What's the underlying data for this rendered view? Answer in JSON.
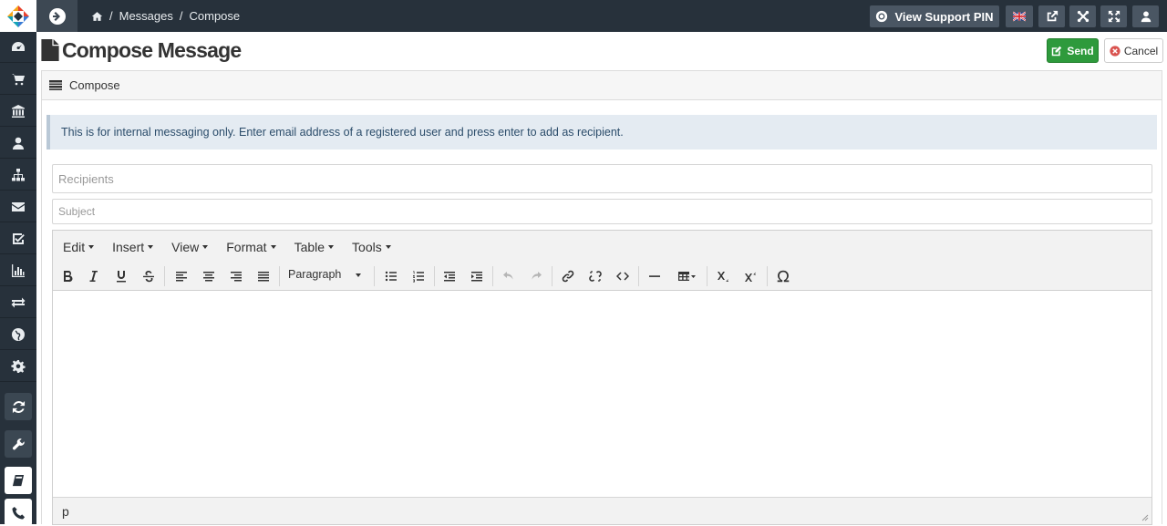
{
  "breadcrumb": {
    "current_section": "Messages",
    "separator": "/",
    "current_page": "Compose"
  },
  "topbar": {
    "support_pin_label": "View Support PIN"
  },
  "page": {
    "title": "Compose Message"
  },
  "actions": {
    "send_label": "Send",
    "cancel_label": "Cancel"
  },
  "panel": {
    "heading": "Compose"
  },
  "alert": {
    "text": "This is for internal messaging only. Enter email address of a registered user and press enter to add as recipient."
  },
  "form": {
    "recipients_placeholder": "Recipients",
    "subject_placeholder": "Subject"
  },
  "editor": {
    "menus": [
      "Edit",
      "Insert",
      "View",
      "Format",
      "Table",
      "Tools"
    ],
    "block_format": "Paragraph",
    "status_path": "p"
  },
  "colors": {
    "sidebar": "#27313b",
    "send_button": "#2e9a3c",
    "alert_bg": "#e4ebf2",
    "alert_text": "#2b4c6a"
  }
}
